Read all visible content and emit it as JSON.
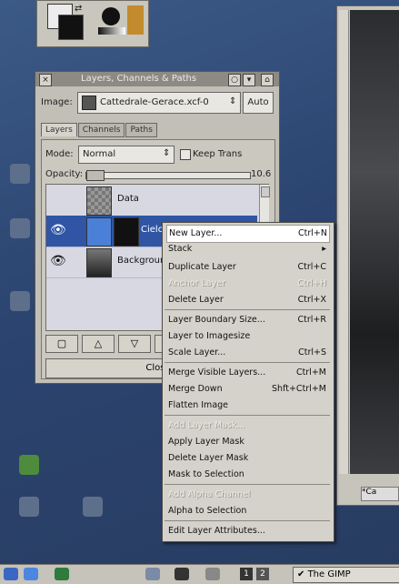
{
  "dialog": {
    "title": "Layers, Channels & Paths",
    "image_label": "Image:",
    "image_value": "Cattedrale-Gerace.xcf-0",
    "auto_label": "Auto",
    "tabs": [
      "Layers",
      "Channels",
      "Paths"
    ],
    "mode_label": "Mode:",
    "mode_value": "Normal",
    "keep_trans_label": "Keep Trans",
    "opacity_label": "Opacity:",
    "opacity_value": "10.6",
    "layers": [
      "Data",
      "Cielo",
      "Background"
    ],
    "close_label": "Close"
  },
  "menu": {
    "items": [
      {
        "label": "New Layer...",
        "shortcut": "Ctrl+N"
      },
      {
        "label": "Stack",
        "shortcut": "▸"
      },
      {
        "label": "Duplicate Layer",
        "shortcut": "Ctrl+C"
      },
      {
        "label": "Anchor Layer",
        "shortcut": "Ctrl+H"
      },
      {
        "label": "Delete Layer",
        "shortcut": "Ctrl+X"
      },
      {
        "label": "Layer Boundary Size...",
        "shortcut": "Ctrl+R"
      },
      {
        "label": "Layer to Imagesize",
        "shortcut": ""
      },
      {
        "label": "Scale Layer...",
        "shortcut": "Ctrl+S"
      },
      {
        "label": "Merge Visible Layers...",
        "shortcut": "Ctrl+M"
      },
      {
        "label": "Merge Down",
        "shortcut": "Shft+Ctrl+M"
      },
      {
        "label": "Flatten Image",
        "shortcut": ""
      },
      {
        "label": "Add Layer Mask...",
        "shortcut": ""
      },
      {
        "label": "Apply Layer Mask",
        "shortcut": ""
      },
      {
        "label": "Delete Layer Mask",
        "shortcut": ""
      },
      {
        "label": "Mask to Selection",
        "shortcut": ""
      },
      {
        "label": "Add Alpha Channel",
        "shortcut": ""
      },
      {
        "label": "Alpha to Selection",
        "shortcut": ""
      },
      {
        "label": "Edit Layer Attributes...",
        "shortcut": ""
      }
    ]
  },
  "taskbar": {
    "workspace_1": "1",
    "workspace_2": "2",
    "task_label": "The GIMP"
  },
  "image_window": {
    "status_text": "*Ca"
  },
  "colors": {
    "dialog_bg": "#c2bfb7",
    "menu_bg": "#d5d2cb",
    "desktop": "#2b4470"
  }
}
